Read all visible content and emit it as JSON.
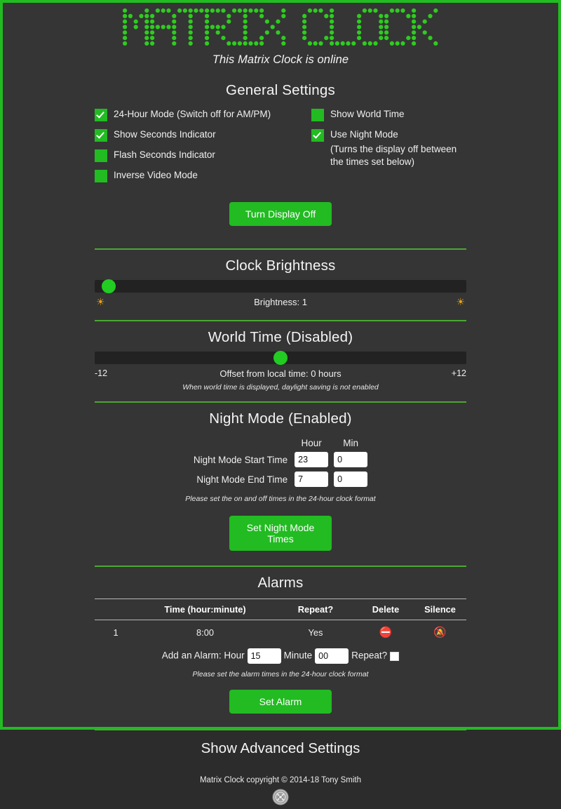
{
  "app": {
    "title": "MATRIX CLOCK",
    "tagline": "This Matrix Clock is online",
    "accent_green": "#22bb22",
    "background": "#353535",
    "border_green": "#22bb22"
  },
  "general": {
    "heading": "General Settings",
    "left_options": [
      {
        "label": "24-Hour Mode (Switch off for AM/PM)",
        "checked": true
      },
      {
        "label": "Show Seconds Indicator",
        "checked": true
      },
      {
        "label": "Flash Seconds Indicator",
        "checked": false
      },
      {
        "label": "Inverse Video Mode",
        "checked": false
      }
    ],
    "right_options": [
      {
        "label": "Show World Time",
        "checked": false
      },
      {
        "label": "Use Night Mode",
        "checked": true
      }
    ],
    "night_mode_note_line1": "(Turns the display off between",
    "night_mode_note_line2": "the times set below)",
    "display_button": "Turn Display Off"
  },
  "brightness": {
    "heading": "Clock Brightness",
    "value_label": "Brightness: 1",
    "value": 1,
    "min": 0,
    "max": 15,
    "thumb_percent": 2,
    "low_icon": "sun-dim-icon",
    "high_icon": "sun-bright-icon",
    "low_glyph": "☀",
    "high_glyph": "☀"
  },
  "world_time": {
    "heading": "World Time (Disabled)",
    "min_label": "-12",
    "max_label": "+12",
    "value_label": "Offset from local time: 0 hours",
    "value": 0,
    "thumb_percent": 50,
    "note": "When world time is displayed, daylight saving is not enabled"
  },
  "night_mode": {
    "heading": "Night Mode (Enabled)",
    "col_hour": "Hour",
    "col_min": "Min",
    "start_label": "Night Mode Start Time",
    "start_hour": "23",
    "start_min": "0",
    "end_label": "Night Mode End Time",
    "end_hour": "7",
    "end_min": "0",
    "note": "Please set the on and off times in the 24-hour clock format",
    "button": "Set Night Mode Times"
  },
  "alarms": {
    "heading": "Alarms",
    "columns": [
      "",
      "Time (hour:minute)",
      "Repeat?",
      "Delete",
      "Silence"
    ],
    "rows": [
      {
        "index": "1",
        "time": "8:00",
        "repeat": "Yes",
        "delete_icon": "no-entry-icon",
        "delete_glyph": "⛔",
        "silence_icon": "bell-muted-icon",
        "silence_glyph": "🔕"
      }
    ],
    "add_prefix": "Add an Alarm: Hour",
    "add_hour": "15",
    "add_minute_label": "Minute",
    "add_minute": "00",
    "add_repeat_label": "Repeat?",
    "add_repeat_checked": false,
    "note": "Please set the alarm times in the 24-hour clock format",
    "button": "Set Alarm"
  },
  "footer": {
    "advanced_link": "Show Advanced Settings",
    "copyright": "Matrix Clock copyright © 2014-18 Tony Smith",
    "logo_icon": "circular-emblem-logo"
  }
}
